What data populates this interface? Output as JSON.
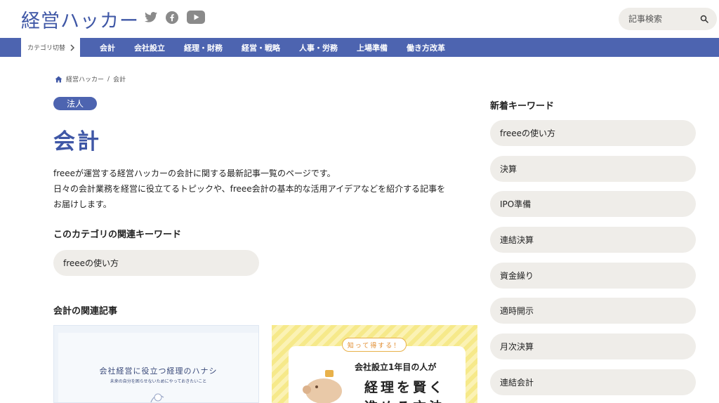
{
  "header": {
    "logo": "経営ハッカー",
    "social": [
      "twitter-icon",
      "facebook-icon",
      "youtube-icon"
    ],
    "search_placeholder": "記事検索"
  },
  "nav": {
    "category_switch": "カテゴリ切替",
    "items": [
      "会計",
      "会社設立",
      "経理・財務",
      "経営・戦略",
      "人事・労務",
      "上場準備",
      "働き方改革"
    ]
  },
  "breadcrumb": {
    "home": "経営ハッカー",
    "separator": "/",
    "current": "会計"
  },
  "main": {
    "badge": "法人",
    "title": "会計",
    "description_lines": [
      "freeeが運営する経営ハッカーの会計に関する最新記事一覧のページです。",
      "日々の会計業務を経営に役立てるトピックや、freee会計の基本的な活用アイデアなどを紹介する記事を",
      "お届けします。"
    ],
    "related_keywords_heading": "このカテゴリの関連キーワード",
    "related_keywords": [
      "freeeの使い方"
    ],
    "related_articles_heading": "会計の関連記事",
    "card1": {
      "title": "会社経営に役立つ経理のハナシ",
      "subtitle": "未来の自分を困らせないためにやっておきたいこと"
    },
    "card2": {
      "tag": "知って得する！",
      "line1": "会社設立1年目の人が",
      "line2": "経理を賢く",
      "line3": "進める方法"
    }
  },
  "sidebar": {
    "heading": "新着キーワード",
    "keywords": [
      "freeeの使い方",
      "決算",
      "IPO準備",
      "連結決算",
      "資金繰り",
      "適時開示",
      "月次決算",
      "連結会計"
    ]
  },
  "colors": {
    "brand": "#4d64b0",
    "title": "#3f57a6",
    "pill": "#efede9"
  }
}
